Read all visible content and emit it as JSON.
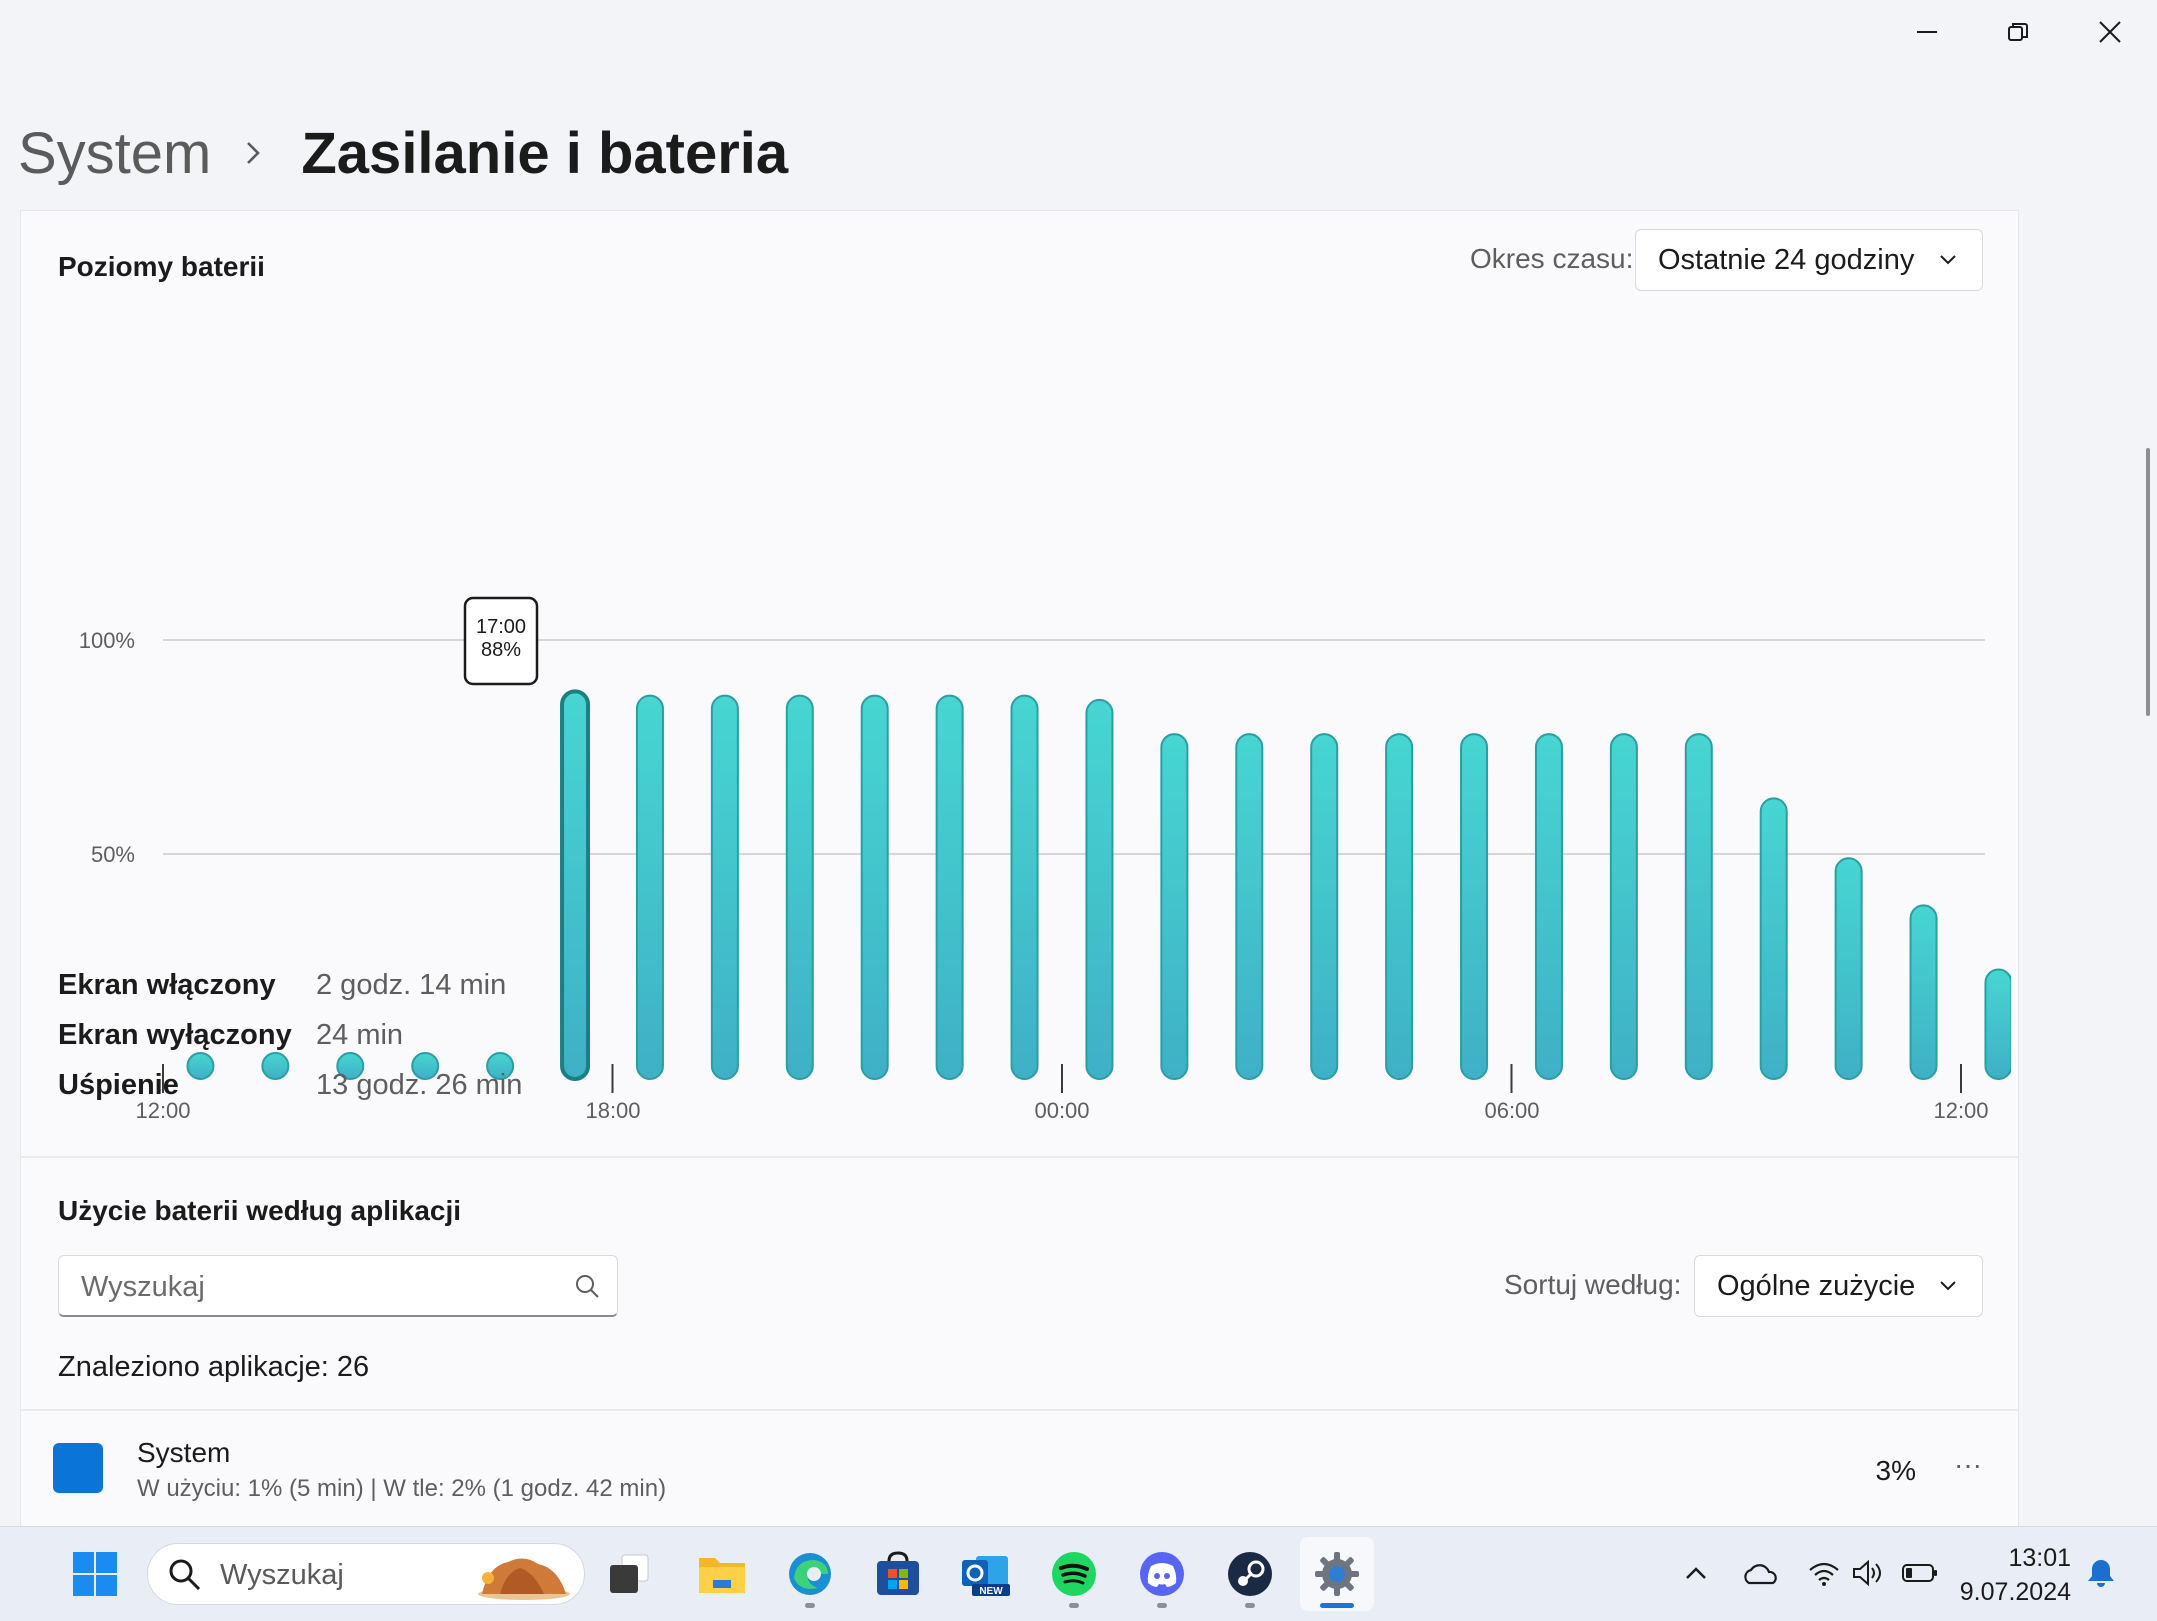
{
  "breadcrumb": {
    "parent": "System",
    "current": "Zasilanie i bateria"
  },
  "battery_levels": {
    "title": "Poziomy baterii",
    "period_label": "Okres czasu:",
    "period_value": "Ostatnie 24 godziny",
    "tooltip": {
      "time": "17:00",
      "value": "88%"
    },
    "y_labels": [
      "100%",
      "50%"
    ],
    "x_labels": [
      "12:00",
      "18:00",
      "00:00",
      "06:00",
      "12:00"
    ]
  },
  "chart_data": {
    "type": "bar",
    "title": "Poziomy baterii",
    "categories": [
      "12:00",
      "13:00",
      "14:00",
      "15:00",
      "16:00",
      "17:00",
      "18:00",
      "19:00",
      "20:00",
      "21:00",
      "22:00",
      "23:00",
      "00:00",
      "01:00",
      "02:00",
      "03:00",
      "04:00",
      "05:00",
      "06:00",
      "07:00",
      "08:00",
      "09:00",
      "10:00",
      "11:00"
    ],
    "values": [
      0,
      0,
      0,
      0,
      0,
      88,
      87,
      87,
      87,
      87,
      87,
      87,
      86,
      78,
      78,
      78,
      78,
      78,
      78,
      78,
      78,
      63,
      49,
      38,
      23
    ],
    "ylim": [
      0,
      100
    ],
    "highlighted": "17:00",
    "grid": true,
    "color": "#3fcfcc"
  },
  "usage": [
    {
      "label": "Ekran włączony",
      "value": "2 godz. 14 min"
    },
    {
      "label": "Ekran wyłączony",
      "value": "24 min"
    },
    {
      "label": "Uśpienie",
      "value": "13 godz. 26 min"
    }
  ],
  "app_usage": {
    "title": "Użycie baterii według aplikacji",
    "search_placeholder": "Wyszukaj",
    "sort_label": "Sortuj według:",
    "sort_value": "Ogólne zużycie",
    "found_text": "Znaleziono aplikacje: 26",
    "apps": [
      {
        "name": "System",
        "detail": "W użyciu: 1% (5 min) | W tle: 2% (1 godz. 42 min)",
        "percent": "3%",
        "more": "···"
      }
    ]
  },
  "taskbar": {
    "search_placeholder": "Wyszukaj",
    "apps": [
      "start-icon",
      "task-view-icon",
      "file-explorer-icon",
      "edge-icon",
      "store-icon",
      "outlook-icon",
      "spotify-icon",
      "discord-icon",
      "steam-icon",
      "settings-icon"
    ],
    "outlook_badge": "NEW",
    "time": "13:01",
    "date": "9.07.2024"
  }
}
